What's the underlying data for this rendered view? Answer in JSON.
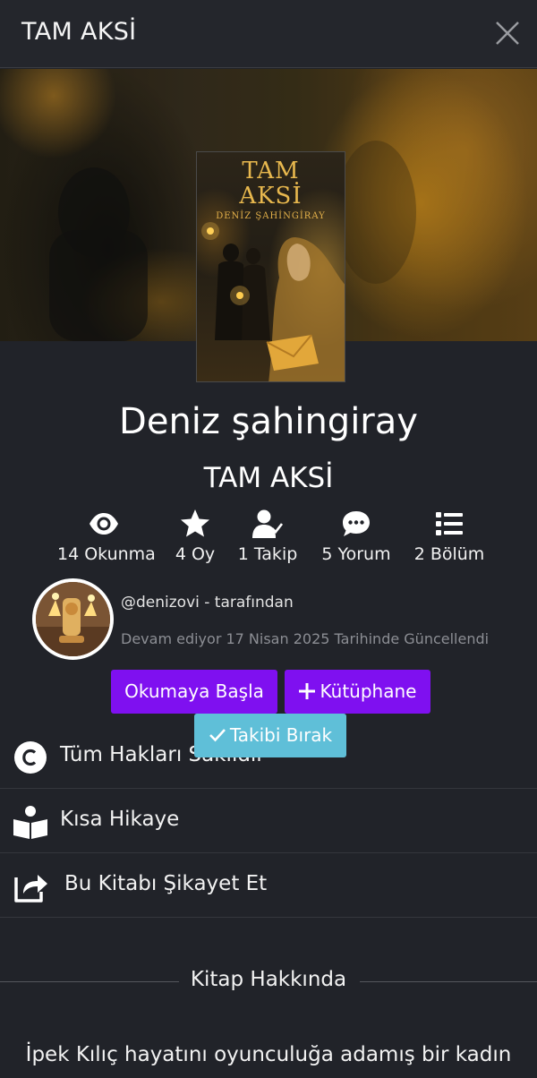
{
  "header": {
    "title": "TAM AKSİ",
    "close_icon": "close-icon"
  },
  "book": {
    "cover_title_line1": "TAM",
    "cover_title_line2": "AKSİ",
    "cover_author": "DENİZ ŞAHİNGİRAY",
    "author_name": "Deniz şahingiray",
    "title": "TAM AKSİ"
  },
  "stats": [
    {
      "icon": "eye-icon",
      "label": "14 Okunma"
    },
    {
      "icon": "star-icon",
      "label": "4 Oy"
    },
    {
      "icon": "user-check-icon",
      "label": "1 Takip"
    },
    {
      "icon": "comment-icon",
      "label": "5 Yorum"
    },
    {
      "icon": "list-icon",
      "label": "2 Bölüm"
    }
  ],
  "author": {
    "byline": "@denizovi - tarafından",
    "status": "Devam ediyor 17 Nisan 2025 Tarihinde Güncellendi"
  },
  "actions": {
    "start_reading": "Okumaya Başla",
    "library": "Kütüphane",
    "unfollow": "Takibi Bırak"
  },
  "info_rows": [
    {
      "icon": "copyright-icon",
      "label": "Tüm Hakları Saklıdır"
    },
    {
      "icon": "reading-person-icon",
      "label": "Kısa Hikaye"
    },
    {
      "icon": "share-report-icon",
      "label": "Bu Kitabı Şikayet Et"
    }
  ],
  "about": {
    "heading": "Kitap Hakkında",
    "text": "İpek Kılıç hayatını oyunculuğa adamış bir kadın"
  },
  "colors": {
    "primary": "#7f10f0",
    "follow": "#5fbfd8",
    "background": "#212329"
  }
}
